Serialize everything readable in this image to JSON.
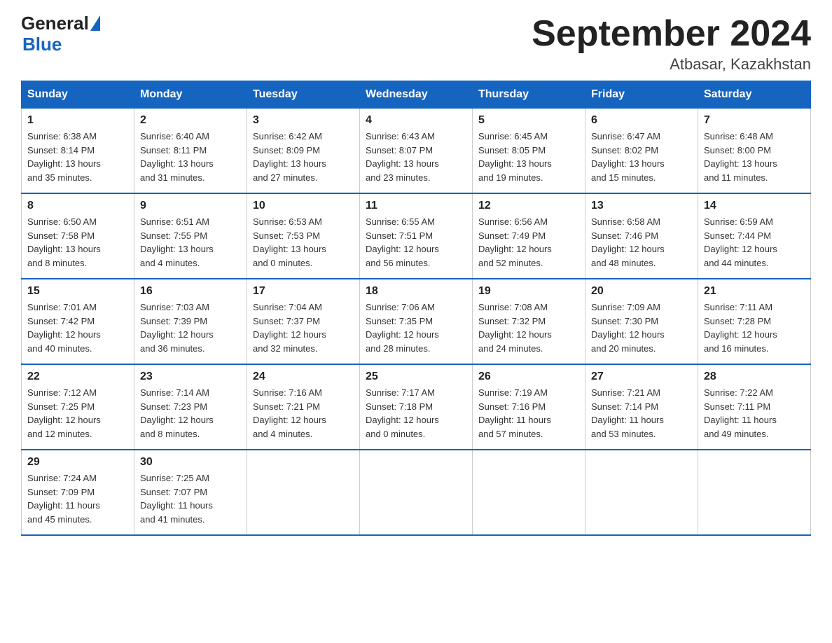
{
  "header": {
    "logo": {
      "general": "General",
      "blue": "Blue"
    },
    "title": "September 2024",
    "location": "Atbasar, Kazakhstan"
  },
  "days_of_week": [
    "Sunday",
    "Monday",
    "Tuesday",
    "Wednesday",
    "Thursday",
    "Friday",
    "Saturday"
  ],
  "weeks": [
    [
      {
        "day": "1",
        "sunrise": "6:38 AM",
        "sunset": "8:14 PM",
        "daylight": "13 hours and 35 minutes."
      },
      {
        "day": "2",
        "sunrise": "6:40 AM",
        "sunset": "8:11 PM",
        "daylight": "13 hours and 31 minutes."
      },
      {
        "day": "3",
        "sunrise": "6:42 AM",
        "sunset": "8:09 PM",
        "daylight": "13 hours and 27 minutes."
      },
      {
        "day": "4",
        "sunrise": "6:43 AM",
        "sunset": "8:07 PM",
        "daylight": "13 hours and 23 minutes."
      },
      {
        "day": "5",
        "sunrise": "6:45 AM",
        "sunset": "8:05 PM",
        "daylight": "13 hours and 19 minutes."
      },
      {
        "day": "6",
        "sunrise": "6:47 AM",
        "sunset": "8:02 PM",
        "daylight": "13 hours and 15 minutes."
      },
      {
        "day": "7",
        "sunrise": "6:48 AM",
        "sunset": "8:00 PM",
        "daylight": "13 hours and 11 minutes."
      }
    ],
    [
      {
        "day": "8",
        "sunrise": "6:50 AM",
        "sunset": "7:58 PM",
        "daylight": "13 hours and 8 minutes."
      },
      {
        "day": "9",
        "sunrise": "6:51 AM",
        "sunset": "7:55 PM",
        "daylight": "13 hours and 4 minutes."
      },
      {
        "day": "10",
        "sunrise": "6:53 AM",
        "sunset": "7:53 PM",
        "daylight": "13 hours and 0 minutes."
      },
      {
        "day": "11",
        "sunrise": "6:55 AM",
        "sunset": "7:51 PM",
        "daylight": "12 hours and 56 minutes."
      },
      {
        "day": "12",
        "sunrise": "6:56 AM",
        "sunset": "7:49 PM",
        "daylight": "12 hours and 52 minutes."
      },
      {
        "day": "13",
        "sunrise": "6:58 AM",
        "sunset": "7:46 PM",
        "daylight": "12 hours and 48 minutes."
      },
      {
        "day": "14",
        "sunrise": "6:59 AM",
        "sunset": "7:44 PM",
        "daylight": "12 hours and 44 minutes."
      }
    ],
    [
      {
        "day": "15",
        "sunrise": "7:01 AM",
        "sunset": "7:42 PM",
        "daylight": "12 hours and 40 minutes."
      },
      {
        "day": "16",
        "sunrise": "7:03 AM",
        "sunset": "7:39 PM",
        "daylight": "12 hours and 36 minutes."
      },
      {
        "day": "17",
        "sunrise": "7:04 AM",
        "sunset": "7:37 PM",
        "daylight": "12 hours and 32 minutes."
      },
      {
        "day": "18",
        "sunrise": "7:06 AM",
        "sunset": "7:35 PM",
        "daylight": "12 hours and 28 minutes."
      },
      {
        "day": "19",
        "sunrise": "7:08 AM",
        "sunset": "7:32 PM",
        "daylight": "12 hours and 24 minutes."
      },
      {
        "day": "20",
        "sunrise": "7:09 AM",
        "sunset": "7:30 PM",
        "daylight": "12 hours and 20 minutes."
      },
      {
        "day": "21",
        "sunrise": "7:11 AM",
        "sunset": "7:28 PM",
        "daylight": "12 hours and 16 minutes."
      }
    ],
    [
      {
        "day": "22",
        "sunrise": "7:12 AM",
        "sunset": "7:25 PM",
        "daylight": "12 hours and 12 minutes."
      },
      {
        "day": "23",
        "sunrise": "7:14 AM",
        "sunset": "7:23 PM",
        "daylight": "12 hours and 8 minutes."
      },
      {
        "day": "24",
        "sunrise": "7:16 AM",
        "sunset": "7:21 PM",
        "daylight": "12 hours and 4 minutes."
      },
      {
        "day": "25",
        "sunrise": "7:17 AM",
        "sunset": "7:18 PM",
        "daylight": "12 hours and 0 minutes."
      },
      {
        "day": "26",
        "sunrise": "7:19 AM",
        "sunset": "7:16 PM",
        "daylight": "11 hours and 57 minutes."
      },
      {
        "day": "27",
        "sunrise": "7:21 AM",
        "sunset": "7:14 PM",
        "daylight": "11 hours and 53 minutes."
      },
      {
        "day": "28",
        "sunrise": "7:22 AM",
        "sunset": "7:11 PM",
        "daylight": "11 hours and 49 minutes."
      }
    ],
    [
      {
        "day": "29",
        "sunrise": "7:24 AM",
        "sunset": "7:09 PM",
        "daylight": "11 hours and 45 minutes."
      },
      {
        "day": "30",
        "sunrise": "7:25 AM",
        "sunset": "7:07 PM",
        "daylight": "11 hours and 41 minutes."
      },
      null,
      null,
      null,
      null,
      null
    ]
  ],
  "labels": {
    "sunrise": "Sunrise:",
    "sunset": "Sunset:",
    "daylight": "Daylight:"
  }
}
